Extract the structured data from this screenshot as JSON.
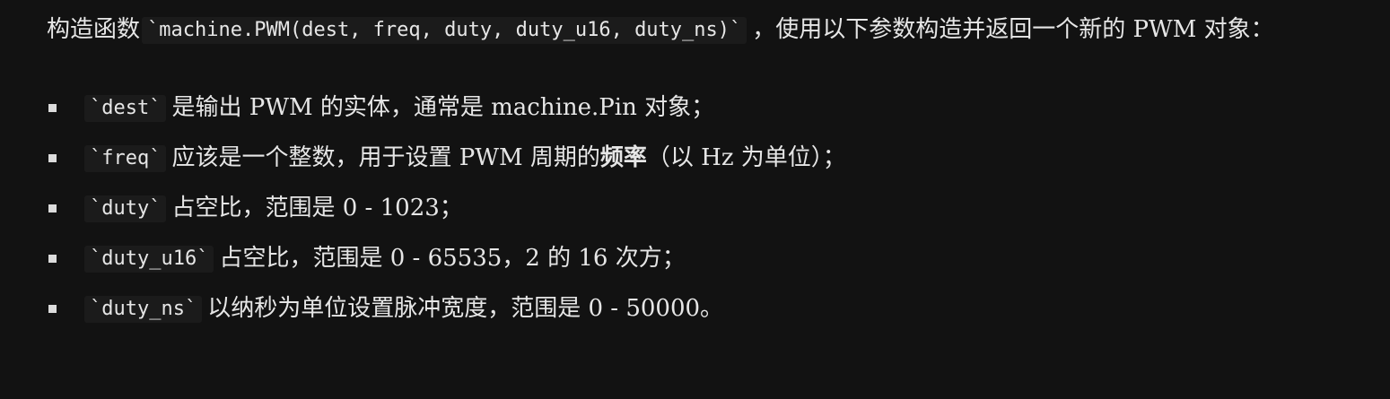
{
  "intro": {
    "prefix": "构造函数",
    "signature": "`machine.PWM(dest, freq, duty, duty_u16, duty_ns)`",
    "suffix": "，使用以下参数构造并返回一个新的 PWM 对象："
  },
  "params": [
    {
      "code": "`dest`",
      "desc": "是输出 PWM 的实体，通常是 machine.Pin 对象；"
    },
    {
      "code": "`freq`",
      "desc_before": "应该是一个整数，用于设置 PWM 周期的",
      "desc_bold": "频率",
      "desc_after": "（以 Hz 为单位）；"
    },
    {
      "code": "`duty`",
      "desc": "占空比，范围是 0 - 1023；"
    },
    {
      "code": "`duty_u16`",
      "desc": "占空比，范围是 0 - 65535，2 的 16 次方；"
    },
    {
      "code": "`duty_ns`",
      "desc": "以纳秒为单位设置脉冲宽度，范围是 0 - 50000。"
    }
  ]
}
